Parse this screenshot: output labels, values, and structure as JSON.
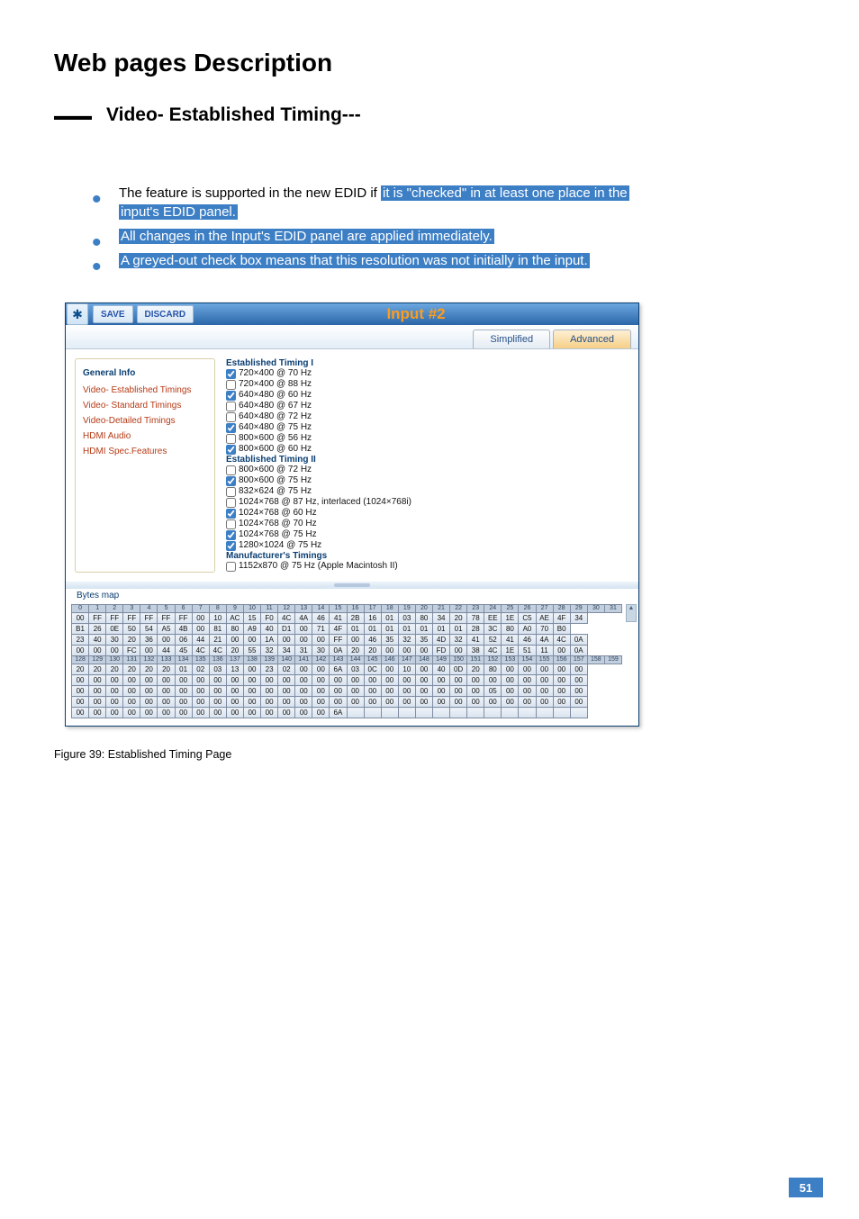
{
  "top_title": "Web pages Description",
  "strip_title": "Video- Established Timing---",
  "notes": [
    {
      "pre": "The feature is supported in the new EDID if ",
      "hl": "it is \"checked\" in at least one place in the",
      "post": ""
    },
    {
      "pre": "",
      "hl": "input's EDID panel.",
      "post": ""
    },
    {
      "pre": "",
      "hl": "All changes in the Input's EDID panel are applied immediately.",
      "post": ""
    },
    {
      "pre": "",
      "hl": "A greyed-out check box means that this resolution was not initially in the input.",
      "post": ""
    }
  ],
  "titlebar": {
    "save": "SAVE",
    "discard": "DISCARD",
    "title": "Input #2"
  },
  "tabs": {
    "simplified": "Simplified",
    "advanced": "Advanced"
  },
  "nav": {
    "header": "General Info",
    "items": [
      "Video- Established Timings",
      "Video- Standard Timings",
      "Video-Detailed Timings",
      "HDMI Audio",
      "HDMI Spec.Features"
    ]
  },
  "est": {
    "h1": "Established Timing I",
    "t1": [
      {
        "c": true,
        "t": "720×400 @ 70 Hz"
      },
      {
        "c": false,
        "t": "720×400 @ 88 Hz"
      },
      {
        "c": true,
        "t": "640×480 @ 60 Hz"
      },
      {
        "c": false,
        "t": "640×480 @ 67 Hz"
      },
      {
        "c": false,
        "t": "640×480 @ 72 Hz"
      },
      {
        "c": true,
        "t": "640×480 @ 75 Hz"
      },
      {
        "c": false,
        "t": "800×600 @ 56 Hz"
      },
      {
        "c": true,
        "t": "800×600 @ 60 Hz"
      }
    ],
    "h2": "Established Timing II",
    "t2": [
      {
        "c": false,
        "t": "800×600 @ 72 Hz"
      },
      {
        "c": true,
        "t": "800×600 @ 75 Hz"
      },
      {
        "c": false,
        "t": "832×624 @ 75 Hz"
      },
      {
        "c": false,
        "t": "1024×768 @ 87 Hz, interlaced (1024×768i)"
      },
      {
        "c": true,
        "t": "1024×768 @ 60 Hz"
      },
      {
        "c": false,
        "t": "1024×768 @ 70 Hz"
      },
      {
        "c": true,
        "t": "1024×768 @ 75 Hz"
      },
      {
        "c": true,
        "t": "1280×1024 @ 75 Hz"
      }
    ],
    "h3": "Manufacturer's Timings",
    "t3": [
      {
        "c": false,
        "t": "1152x870 @ 75 Hz (Apple Macintosh II)"
      }
    ]
  },
  "bytes": {
    "label": "Bytes map",
    "idx0": [
      "0",
      "1",
      "2",
      "3",
      "4",
      "5",
      "6",
      "7",
      "8",
      "9",
      "10",
      "11",
      "12",
      "13",
      "14",
      "15",
      "16",
      "17",
      "18",
      "19",
      "20",
      "21",
      "22",
      "23",
      "24",
      "25",
      "26",
      "27",
      "28",
      "29",
      "30",
      "31"
    ],
    "rows": [
      [
        "00",
        "FF",
        "FF",
        "FF",
        "FF",
        "FF",
        "FF",
        "00",
        "10",
        "AC",
        "15",
        "F0",
        "4C",
        "4A",
        "46",
        "41",
        "2B",
        "16",
        "01",
        "03",
        "80",
        "34",
        "20",
        "78",
        "EE",
        "1E",
        "C5",
        "AE",
        "4F",
        "34"
      ],
      [
        "B1",
        "26",
        "0E",
        "50",
        "54",
        "A5",
        "4B",
        "00",
        "81",
        "80",
        "A9",
        "40",
        "D1",
        "00",
        "71",
        "4F",
        "01",
        "01",
        "01",
        "01",
        "01",
        "01",
        "01",
        "28",
        "3C",
        "80",
        "A0",
        "70",
        "B0"
      ],
      [
        "23",
        "40",
        "30",
        "20",
        "36",
        "00",
        "06",
        "44",
        "21",
        "00",
        "00",
        "1A",
        "00",
        "00",
        "00",
        "FF",
        "00",
        "46",
        "35",
        "32",
        "35",
        "4D",
        "32",
        "41",
        "52",
        "41",
        "46",
        "4A",
        "4C",
        "0A"
      ],
      [
        "00",
        "00",
        "00",
        "FC",
        "00",
        "44",
        "45",
        "4C",
        "4C",
        "20",
        "55",
        "32",
        "34",
        "31",
        "30",
        "0A",
        "20",
        "20",
        "00",
        "00",
        "00",
        "FD",
        "00",
        "38",
        "4C",
        "1E",
        "51",
        "11",
        "00",
        "0A"
      ]
    ],
    "idx1": [
      "128",
      "129",
      "130",
      "131",
      "132",
      "133",
      "134",
      "135",
      "136",
      "137",
      "138",
      "139",
      "140",
      "141",
      "142",
      "143",
      "144",
      "145",
      "146",
      "147",
      "148",
      "149",
      "150",
      "151",
      "152",
      "153",
      "154",
      "155",
      "156",
      "157",
      "158",
      "159"
    ],
    "rows2": [
      [
        "20",
        "20",
        "20",
        "20",
        "20",
        "20",
        "01",
        "02",
        "03",
        "13",
        "00",
        "23",
        "02",
        "00",
        "00",
        "6A",
        "03",
        "0C",
        "00",
        "10",
        "00",
        "40",
        "0D",
        "20",
        "80",
        "00",
        "00",
        "00",
        "00",
        "00"
      ],
      [
        "00",
        "00",
        "00",
        "00",
        "00",
        "00",
        "00",
        "00",
        "00",
        "00",
        "00",
        "00",
        "00",
        "00",
        "00",
        "00",
        "00",
        "00",
        "00",
        "00",
        "00",
        "00",
        "00",
        "00",
        "00",
        "00",
        "00",
        "00",
        "00",
        "00"
      ],
      [
        "00",
        "00",
        "00",
        "00",
        "00",
        "00",
        "00",
        "00",
        "00",
        "00",
        "00",
        "00",
        "00",
        "00",
        "00",
        "00",
        "00",
        "00",
        "00",
        "00",
        "00",
        "00",
        "00",
        "00",
        "05",
        "00",
        "00",
        "00",
        "00",
        "00"
      ],
      [
        "00",
        "00",
        "00",
        "00",
        "00",
        "00",
        "00",
        "00",
        "00",
        "00",
        "00",
        "00",
        "00",
        "00",
        "00",
        "00",
        "00",
        "00",
        "00",
        "00",
        "00",
        "00",
        "00",
        "00",
        "00",
        "00",
        "00",
        "00",
        "00",
        "00"
      ],
      [
        "00",
        "00",
        "00",
        "00",
        "00",
        "00",
        "00",
        "00",
        "00",
        "00",
        "00",
        "00",
        "00",
        "00",
        "00",
        "6A",
        "",
        "",
        "",
        "",
        "",
        "",
        "",
        "",
        "",
        "",
        "",
        "",
        "",
        ""
      ]
    ]
  },
  "figure_caption": "Figure 39: Established Timing Page",
  "page_number": "51"
}
